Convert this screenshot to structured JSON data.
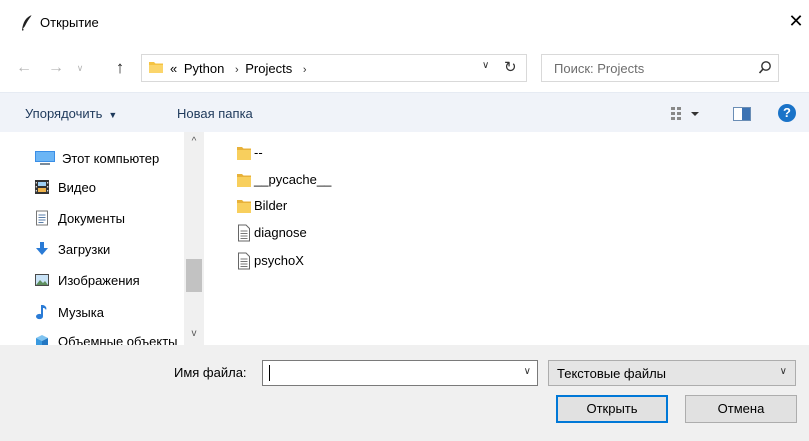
{
  "window": {
    "title": "Открытие",
    "close_glyph": "✕"
  },
  "address_bar": {
    "back_glyph": "←",
    "forward_glyph": "→",
    "up_glyph": "↑",
    "overflow": "«",
    "crumbs": [
      "Python",
      "Projects"
    ],
    "separator": "›",
    "dropdown_glyph": "∨",
    "refresh_glyph": "↻"
  },
  "search": {
    "placeholder": "Поиск: Projects"
  },
  "toolbar": {
    "organize_label": "Упорядочить",
    "organize_caret": "▼",
    "new_folder_label": "Новая папка",
    "help_label": "?"
  },
  "sidebar": {
    "items": [
      {
        "label": "Этот компьютер",
        "icon": "computer-icon"
      },
      {
        "label": "Видео",
        "icon": "video-icon"
      },
      {
        "label": "Документы",
        "icon": "documents-icon"
      },
      {
        "label": "Загрузки",
        "icon": "downloads-icon"
      },
      {
        "label": "Изображения",
        "icon": "pictures-icon"
      },
      {
        "label": "Музыка",
        "icon": "music-icon"
      },
      {
        "label": "Объемные объекты",
        "icon": "3d-objects-icon"
      }
    ],
    "scroll_up": "^",
    "scroll_down": "v"
  },
  "files": {
    "items": [
      {
        "name": "--",
        "type": "folder"
      },
      {
        "name": "__pycache__",
        "type": "folder"
      },
      {
        "name": "Bilder",
        "type": "folder"
      },
      {
        "name": "diagnose",
        "type": "file"
      },
      {
        "name": "psychoX",
        "type": "file"
      }
    ]
  },
  "footer": {
    "filename_label": "Имя файла:",
    "filename_value": "",
    "filename_dropdown": "∨",
    "filetype_label": "Текстовые файлы",
    "filetype_dropdown": "∨",
    "open_label": "Открыть",
    "cancel_label": "Отмена"
  },
  "colors": {
    "accent": "#0078d7",
    "toolbar_bg": "#f0f3f9",
    "toolbar_text": "#1e395b",
    "folder": "#f5c342",
    "help": "#1a73c8"
  }
}
